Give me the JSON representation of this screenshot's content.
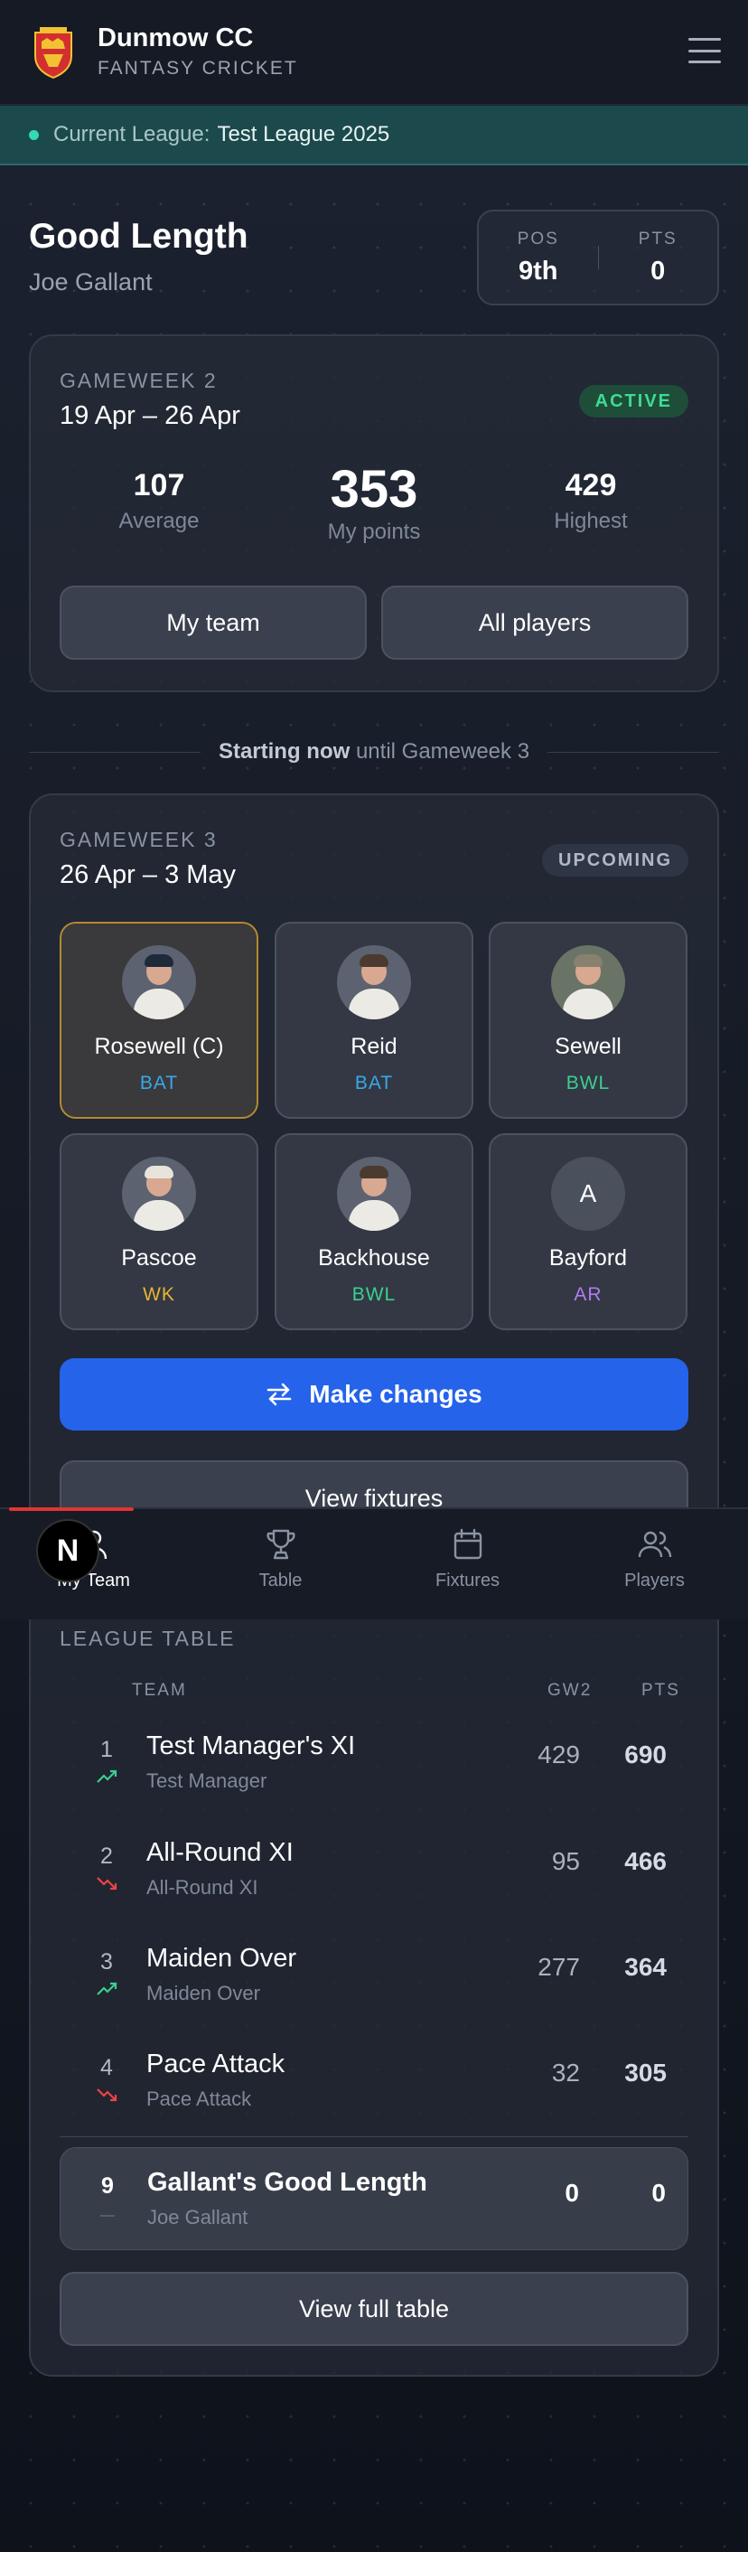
{
  "header": {
    "club": "Dunmow CC",
    "subtitle": "FANTASY CRICKET"
  },
  "league_bar": {
    "prefix": "Current League:",
    "name": "Test League 2025"
  },
  "team": {
    "name": "Good Length",
    "manager": "Joe Gallant",
    "pos_label": "POS",
    "pos": "9th",
    "pts_label": "PTS",
    "pts": "0"
  },
  "gw2": {
    "label": "GAMEWEEK 2",
    "dates": "19 Apr – 26 Apr",
    "status": "ACTIVE",
    "average": "107",
    "average_label": "Average",
    "my_points": "353",
    "my_points_label": "My points",
    "highest": "429",
    "highest_label": "Highest",
    "my_team_btn": "My team",
    "all_players_btn": "All players"
  },
  "divider": {
    "bold": "Starting now",
    "rest": "until Gameweek 3"
  },
  "gw3": {
    "label": "GAMEWEEK 3",
    "dates": "26 Apr – 3 May",
    "status": "UPCOMING",
    "players": [
      {
        "name": "Rosewell (C)",
        "role": "BAT",
        "color": "#38a8e8",
        "captain": true
      },
      {
        "name": "Reid",
        "role": "BAT",
        "color": "#38a8e8"
      },
      {
        "name": "Sewell",
        "role": "BWL",
        "color": "#3ccf8e"
      },
      {
        "name": "Pascoe",
        "role": "WK",
        "color": "#e8b531"
      },
      {
        "name": "Backhouse",
        "role": "BWL",
        "color": "#3ccf8e"
      },
      {
        "name": "Bayford",
        "role": "AR",
        "color": "#b07cf0",
        "initial": "A"
      }
    ],
    "make_changes": "Make changes",
    "view_fixtures": "View fixtures"
  },
  "nav": {
    "items": [
      "My Team",
      "Table",
      "Fixtures",
      "Players"
    ],
    "badge": "N"
  },
  "league_table": {
    "title": "LEAGUE TABLE",
    "col_team": "TEAM",
    "col_gw": "GW2",
    "col_pts": "PTS",
    "rows": [
      {
        "pos": "1",
        "team": "Test Manager's XI",
        "manager": "Test Manager",
        "gw": "429",
        "pts": "690",
        "trend": "up"
      },
      {
        "pos": "2",
        "team": "All-Round XI",
        "manager": "All-Round XI",
        "gw": "95",
        "pts": "466",
        "trend": "down"
      },
      {
        "pos": "3",
        "team": "Maiden Over",
        "manager": "Maiden Over",
        "gw": "277",
        "pts": "364",
        "trend": "up"
      },
      {
        "pos": "4",
        "team": "Pace Attack",
        "manager": "Pace Attack",
        "gw": "32",
        "pts": "305",
        "trend": "down"
      }
    ],
    "me": {
      "pos": "9",
      "team": "Gallant's Good Length",
      "manager": "Joe Gallant",
      "gw": "0",
      "pts": "0"
    },
    "view_full": "View full table"
  },
  "colors": {
    "accent": "#2563eb",
    "active": "#3ddc93",
    "nav_indicator": "#e03535",
    "captain_border": "#b38a30"
  }
}
